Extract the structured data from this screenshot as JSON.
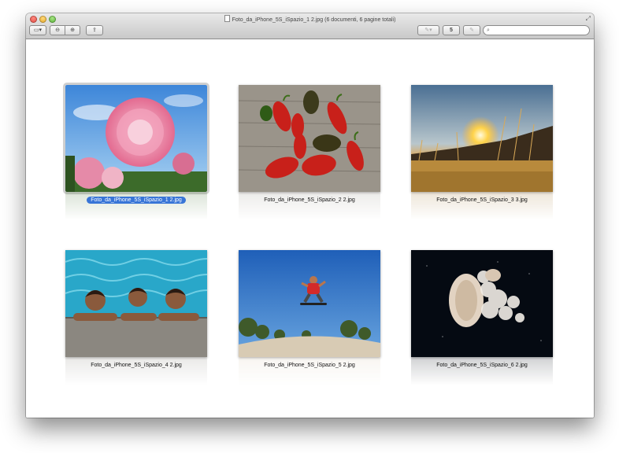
{
  "window": {
    "title": "Foto_da_iPhone_5S_iSpazio_1 2.jpg (6 documenti, 6 pagine totali)",
    "accent": "#3875d7"
  },
  "toolbar": {
    "page_button_label": "5",
    "search_placeholder": "",
    "icons": [
      "sidebar-icon",
      "zoom-out-icon",
      "zoom-in-icon",
      "share-icon",
      "annotate-icon",
      "rotate-icon",
      "search-icon"
    ]
  },
  "thumbnails": [
    {
      "caption": "Foto_da_iPhone_5S_iSpazio_1 2.jpg",
      "selected": true
    },
    {
      "caption": "Foto_da_iPhone_5S_iSpazio_2 2.jpg",
      "selected": false
    },
    {
      "caption": "Foto_da_iPhone_5S_iSpazio_3 3.jpg",
      "selected": false
    },
    {
      "caption": "Foto_da_iPhone_5S_iSpazio_4 2.jpg",
      "selected": false
    },
    {
      "caption": "Foto_da_iPhone_5S_iSpazio_5 2.jpg",
      "selected": false
    },
    {
      "caption": "Foto_da_iPhone_5S_iSpazio_6 2.jpg",
      "selected": false
    }
  ]
}
